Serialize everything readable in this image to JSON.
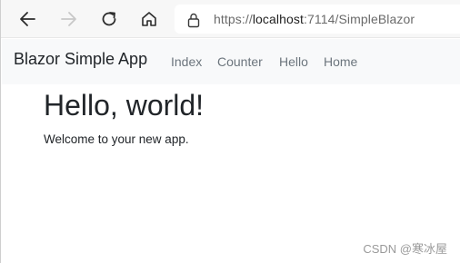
{
  "browser": {
    "url_prefix": "https://",
    "url_host": "localhost",
    "url_path": ":7114/SimpleBlazor",
    "icons": {
      "back": "back-arrow-icon",
      "forward": "forward-arrow-icon",
      "refresh": "refresh-icon",
      "home": "home-icon",
      "lock": "lock-icon"
    },
    "colors": {
      "chrome_bg": "#f7f7f7",
      "forward_disabled": "#c8c8c8"
    }
  },
  "app": {
    "brand": "Blazor Simple App",
    "nav_links": [
      "Index",
      "Counter",
      "Hello",
      "Home"
    ],
    "colors": {
      "navbar_bg": "#f8f9fa",
      "link": "#6c757d"
    }
  },
  "page": {
    "title": "Hello, world!",
    "text": "Welcome to your new app."
  },
  "watermark": "CSDN @寒冰屋"
}
